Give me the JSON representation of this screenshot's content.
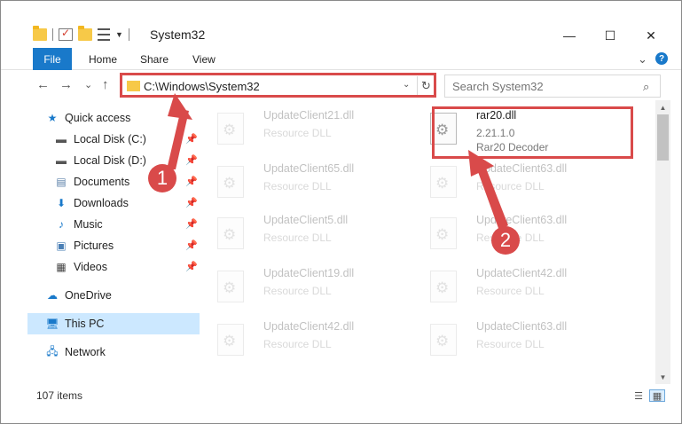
{
  "window": {
    "title": "System32"
  },
  "qat": {
    "icons": [
      "folder-icon",
      "properties-icon",
      "new-folder-icon",
      "customize-icon"
    ]
  },
  "controls": {
    "minimize": "—",
    "maximize": "☐",
    "close": "✕",
    "collapse_ribbon": "⌄",
    "help": "?"
  },
  "ribbon": {
    "file": "File",
    "tabs": [
      "Home",
      "Share",
      "View"
    ]
  },
  "nav": {
    "back": "←",
    "forward": "→",
    "recent": "⌄",
    "up": "↑"
  },
  "address": {
    "path": "C:\\Windows\\System32",
    "dropdown": "⌄",
    "refresh": "↻"
  },
  "search": {
    "placeholder": "Search System32",
    "icon": "⌕"
  },
  "sidebar": {
    "items": [
      {
        "label": "Quick access",
        "icon": "star-icon",
        "pinned": false
      },
      {
        "label": "Local Disk (C:)",
        "icon": "drive-icon",
        "pinned": true
      },
      {
        "label": "Local Disk (D:)",
        "icon": "drive-icon",
        "pinned": true
      },
      {
        "label": "Documents",
        "icon": "documents-icon",
        "pinned": true
      },
      {
        "label": "Downloads",
        "icon": "downloads-icon",
        "pinned": true
      },
      {
        "label": "Music",
        "icon": "music-icon",
        "pinned": true
      },
      {
        "label": "Pictures",
        "icon": "pictures-icon",
        "pinned": true
      },
      {
        "label": "Videos",
        "icon": "videos-icon",
        "pinned": true
      },
      {
        "label": "OneDrive",
        "icon": "onedrive-icon",
        "pinned": false
      },
      {
        "label": "This PC",
        "icon": "pc-icon",
        "pinned": false,
        "selected": true
      },
      {
        "label": "Network",
        "icon": "network-icon",
        "pinned": false
      }
    ]
  },
  "files": [
    {
      "name": "UpdateClient21.dll",
      "line2": "Resource DLL",
      "line3": "",
      "faded": true
    },
    {
      "name": "rar20.dll",
      "line2": "2.21.1.0",
      "line3": "Rar20 Decoder",
      "faded": false
    },
    {
      "name": "UpdateClient65.dll",
      "line2": "Resource DLL",
      "line3": "",
      "faded": true
    },
    {
      "name": "UpdateClient63.dll",
      "line2": "Resource DLL",
      "line3": "",
      "faded": true
    },
    {
      "name": "UpdateClient5.dll",
      "line2": "Resource DLL",
      "line3": "",
      "faded": true
    },
    {
      "name": "UpdateClient63.dll",
      "line2": "Resource DLL",
      "line3": "",
      "faded": true
    },
    {
      "name": "UpdateClient19.dll",
      "line2": "Resource DLL",
      "line3": "",
      "faded": true
    },
    {
      "name": "UpdateClient42.dll",
      "line2": "Resource DLL",
      "line3": "",
      "faded": true
    },
    {
      "name": "UpdateClient42.dll",
      "line2": "Resource DLL",
      "line3": "",
      "faded": true
    },
    {
      "name": "UpdateClient63.dll",
      "line2": "Resource DLL",
      "line3": "",
      "faded": true
    }
  ],
  "status": {
    "count": "107 items",
    "view_details": "☰",
    "view_tiles": "▦"
  },
  "annotations": {
    "marker1": "1",
    "marker2": "2",
    "color": "#d94a4a"
  },
  "colors": {
    "accent": "#1979ca",
    "selection": "#cce8ff"
  }
}
